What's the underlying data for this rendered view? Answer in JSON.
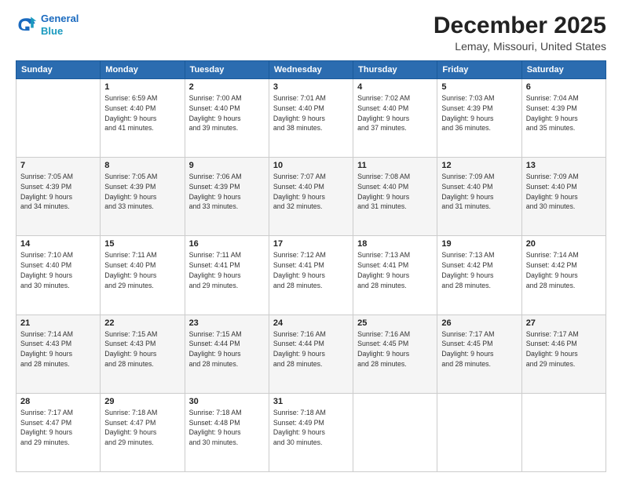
{
  "header": {
    "logo_line1": "General",
    "logo_line2": "Blue",
    "title": "December 2025",
    "subtitle": "Lemay, Missouri, United States"
  },
  "calendar": {
    "days_of_week": [
      "Sunday",
      "Monday",
      "Tuesday",
      "Wednesday",
      "Thursday",
      "Friday",
      "Saturday"
    ],
    "weeks": [
      [
        {
          "day": "",
          "info": ""
        },
        {
          "day": "1",
          "info": "Sunrise: 6:59 AM\nSunset: 4:40 PM\nDaylight: 9 hours\nand 41 minutes."
        },
        {
          "day": "2",
          "info": "Sunrise: 7:00 AM\nSunset: 4:40 PM\nDaylight: 9 hours\nand 39 minutes."
        },
        {
          "day": "3",
          "info": "Sunrise: 7:01 AM\nSunset: 4:40 PM\nDaylight: 9 hours\nand 38 minutes."
        },
        {
          "day": "4",
          "info": "Sunrise: 7:02 AM\nSunset: 4:40 PM\nDaylight: 9 hours\nand 37 minutes."
        },
        {
          "day": "5",
          "info": "Sunrise: 7:03 AM\nSunset: 4:39 PM\nDaylight: 9 hours\nand 36 minutes."
        },
        {
          "day": "6",
          "info": "Sunrise: 7:04 AM\nSunset: 4:39 PM\nDaylight: 9 hours\nand 35 minutes."
        }
      ],
      [
        {
          "day": "7",
          "info": "Sunrise: 7:05 AM\nSunset: 4:39 PM\nDaylight: 9 hours\nand 34 minutes."
        },
        {
          "day": "8",
          "info": "Sunrise: 7:05 AM\nSunset: 4:39 PM\nDaylight: 9 hours\nand 33 minutes."
        },
        {
          "day": "9",
          "info": "Sunrise: 7:06 AM\nSunset: 4:39 PM\nDaylight: 9 hours\nand 33 minutes."
        },
        {
          "day": "10",
          "info": "Sunrise: 7:07 AM\nSunset: 4:40 PM\nDaylight: 9 hours\nand 32 minutes."
        },
        {
          "day": "11",
          "info": "Sunrise: 7:08 AM\nSunset: 4:40 PM\nDaylight: 9 hours\nand 31 minutes."
        },
        {
          "day": "12",
          "info": "Sunrise: 7:09 AM\nSunset: 4:40 PM\nDaylight: 9 hours\nand 31 minutes."
        },
        {
          "day": "13",
          "info": "Sunrise: 7:09 AM\nSunset: 4:40 PM\nDaylight: 9 hours\nand 30 minutes."
        }
      ],
      [
        {
          "day": "14",
          "info": "Sunrise: 7:10 AM\nSunset: 4:40 PM\nDaylight: 9 hours\nand 30 minutes."
        },
        {
          "day": "15",
          "info": "Sunrise: 7:11 AM\nSunset: 4:40 PM\nDaylight: 9 hours\nand 29 minutes."
        },
        {
          "day": "16",
          "info": "Sunrise: 7:11 AM\nSunset: 4:41 PM\nDaylight: 9 hours\nand 29 minutes."
        },
        {
          "day": "17",
          "info": "Sunrise: 7:12 AM\nSunset: 4:41 PM\nDaylight: 9 hours\nand 28 minutes."
        },
        {
          "day": "18",
          "info": "Sunrise: 7:13 AM\nSunset: 4:41 PM\nDaylight: 9 hours\nand 28 minutes."
        },
        {
          "day": "19",
          "info": "Sunrise: 7:13 AM\nSunset: 4:42 PM\nDaylight: 9 hours\nand 28 minutes."
        },
        {
          "day": "20",
          "info": "Sunrise: 7:14 AM\nSunset: 4:42 PM\nDaylight: 9 hours\nand 28 minutes."
        }
      ],
      [
        {
          "day": "21",
          "info": "Sunrise: 7:14 AM\nSunset: 4:43 PM\nDaylight: 9 hours\nand 28 minutes."
        },
        {
          "day": "22",
          "info": "Sunrise: 7:15 AM\nSunset: 4:43 PM\nDaylight: 9 hours\nand 28 minutes."
        },
        {
          "day": "23",
          "info": "Sunrise: 7:15 AM\nSunset: 4:44 PM\nDaylight: 9 hours\nand 28 minutes."
        },
        {
          "day": "24",
          "info": "Sunrise: 7:16 AM\nSunset: 4:44 PM\nDaylight: 9 hours\nand 28 minutes."
        },
        {
          "day": "25",
          "info": "Sunrise: 7:16 AM\nSunset: 4:45 PM\nDaylight: 9 hours\nand 28 minutes."
        },
        {
          "day": "26",
          "info": "Sunrise: 7:17 AM\nSunset: 4:45 PM\nDaylight: 9 hours\nand 28 minutes."
        },
        {
          "day": "27",
          "info": "Sunrise: 7:17 AM\nSunset: 4:46 PM\nDaylight: 9 hours\nand 29 minutes."
        }
      ],
      [
        {
          "day": "28",
          "info": "Sunrise: 7:17 AM\nSunset: 4:47 PM\nDaylight: 9 hours\nand 29 minutes."
        },
        {
          "day": "29",
          "info": "Sunrise: 7:18 AM\nSunset: 4:47 PM\nDaylight: 9 hours\nand 29 minutes."
        },
        {
          "day": "30",
          "info": "Sunrise: 7:18 AM\nSunset: 4:48 PM\nDaylight: 9 hours\nand 30 minutes."
        },
        {
          "day": "31",
          "info": "Sunrise: 7:18 AM\nSunset: 4:49 PM\nDaylight: 9 hours\nand 30 minutes."
        },
        {
          "day": "",
          "info": ""
        },
        {
          "day": "",
          "info": ""
        },
        {
          "day": "",
          "info": ""
        }
      ]
    ]
  }
}
